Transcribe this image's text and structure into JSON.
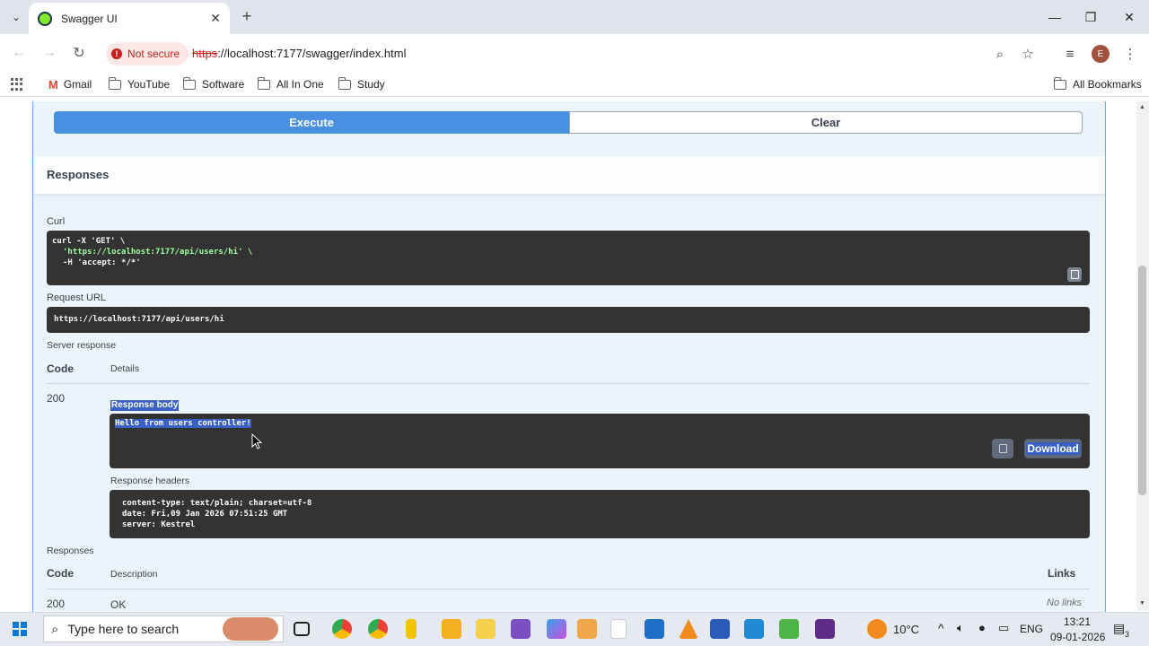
{
  "browser": {
    "tab_title": "Swagger UI",
    "security_label": "Not secure",
    "url_scheme": "https",
    "url_rest": "://localhost:7177/swagger/index.html",
    "profile_initial": "E"
  },
  "bookmarks": [
    {
      "label": "Gmail"
    },
    {
      "label": "YouTube"
    },
    {
      "label": "Software"
    },
    {
      "label": "All In One"
    },
    {
      "label": "Study"
    }
  ],
  "all_bookmarks_label": "All Bookmarks",
  "swagger": {
    "execute_label": "Execute",
    "clear_label": "Clear",
    "responses_title": "Responses",
    "curl_label": "Curl",
    "curl_lines": [
      "curl -X 'GET' \\",
      "'https://localhost:7177/api/users/hi' \\",
      "-H 'accept: */*'"
    ],
    "request_url_label": "Request URL",
    "request_url": "https://localhost:7177/api/users/hi",
    "server_response_label": "Server response",
    "code_header": "Code",
    "details_header": "Details",
    "status_code": "200",
    "response_body_label": "Response body",
    "response_body": "Hello from users controller!",
    "download_label": "Download",
    "response_headers_label": "Response headers",
    "response_headers": [
      "content-type: text/plain; charset=utf-8",
      "date: Fri,09 Jan 2026 07:51:25 GMT",
      "server: Kestrel"
    ],
    "responses_label": "Responses",
    "description_header": "Description",
    "links_header": "Links",
    "doc_code": "200",
    "doc_description": "OK",
    "doc_links": "No links"
  },
  "taskbar": {
    "search_placeholder": "Type here to search",
    "weather": "10°C",
    "language": "ENG",
    "time": "13:21",
    "date": "09-01-2026",
    "notification_count": "3"
  }
}
